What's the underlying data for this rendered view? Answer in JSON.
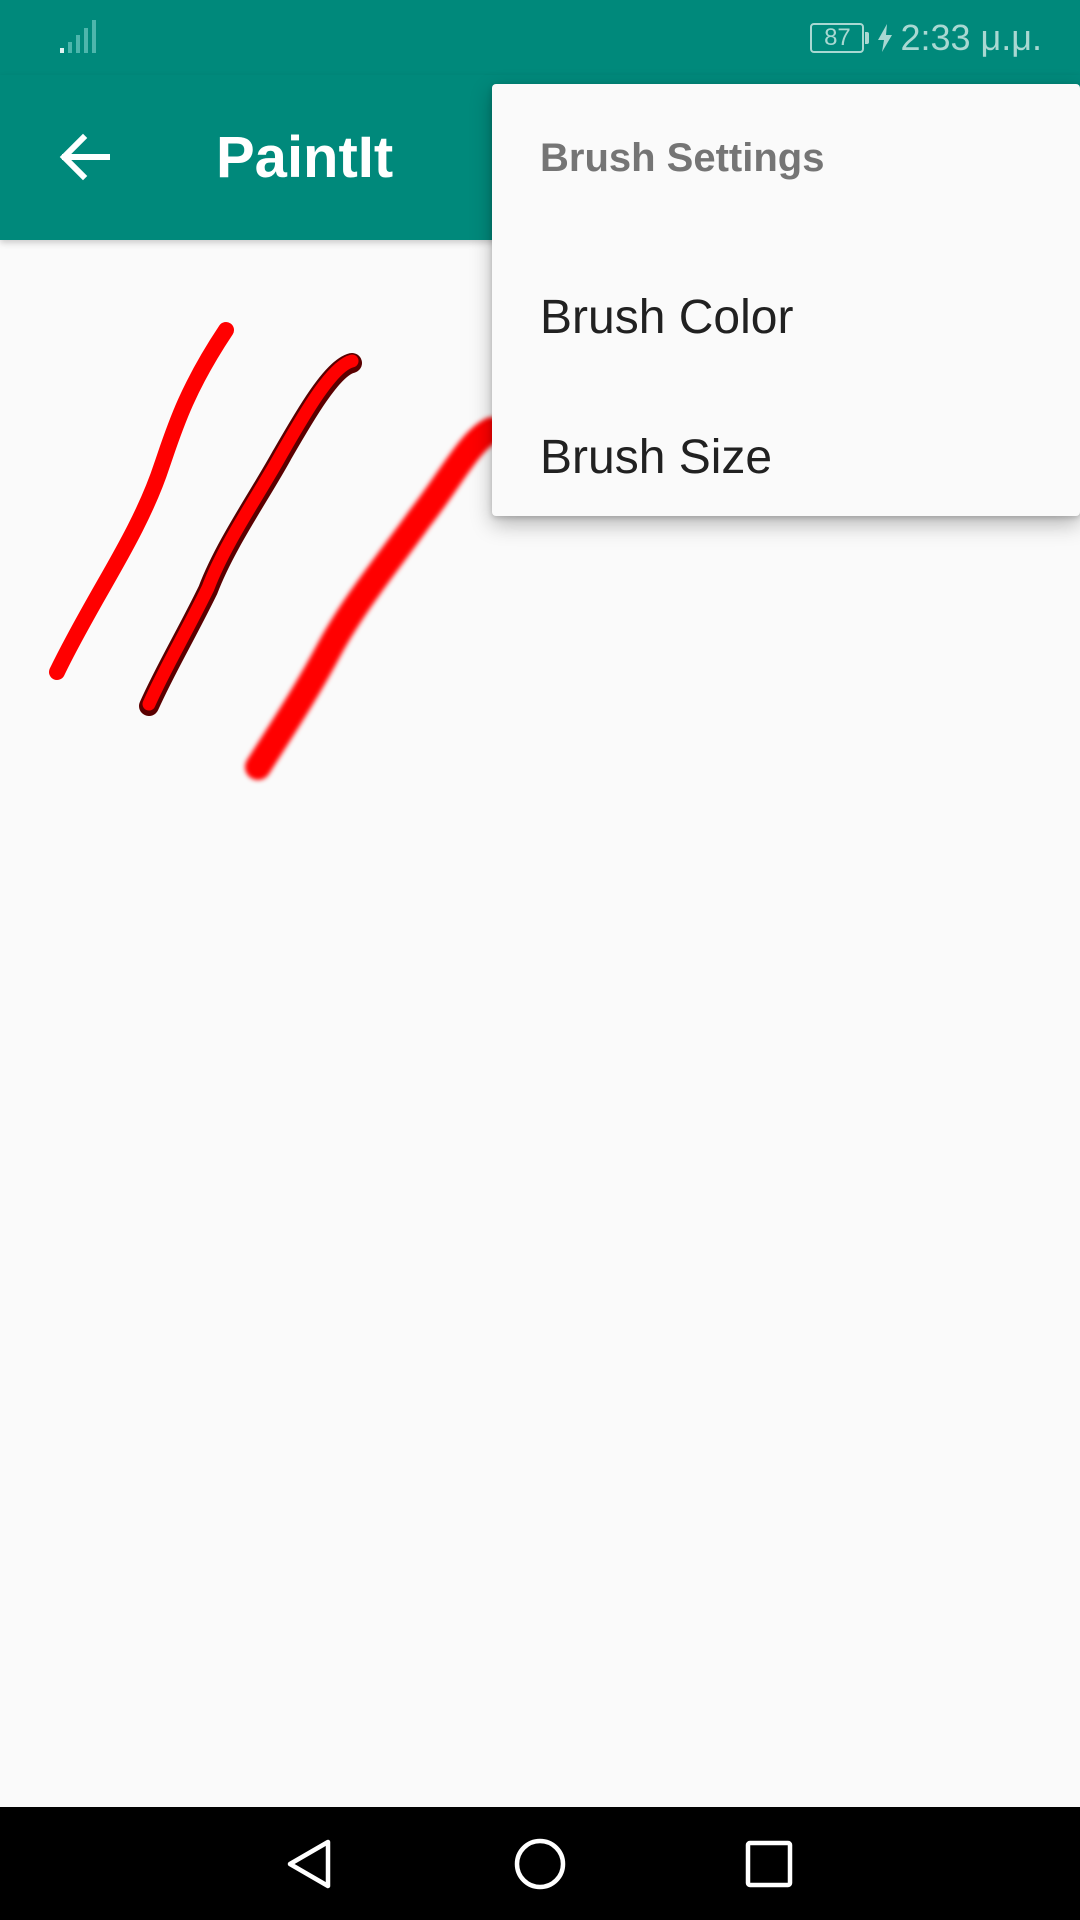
{
  "status_bar": {
    "battery_level": "87",
    "time": "2:33 μ.μ.",
    "background_color": "#00897b",
    "icons": [
      "signal-icon",
      "battery-icon",
      "charging-bolt-icon"
    ]
  },
  "app_bar": {
    "title": "PaintIt",
    "back_icon": "arrow-back-icon",
    "background_color": "#00897b"
  },
  "popup_menu": {
    "header": "Brush Settings",
    "items": [
      {
        "label": "Brush Color"
      },
      {
        "label": "Brush Size"
      }
    ]
  },
  "canvas": {
    "brush_color": "#ff0000",
    "stroke_count": 3
  },
  "nav_bar": {
    "icons": [
      "nav-back-icon",
      "nav-home-icon",
      "nav-recents-icon"
    ]
  }
}
